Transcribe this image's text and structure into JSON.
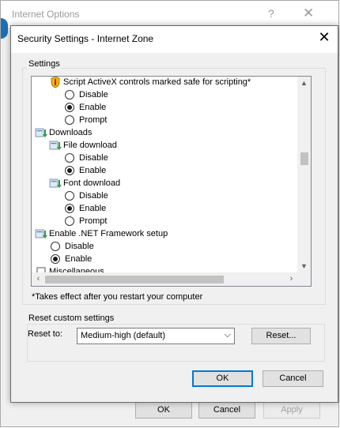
{
  "background_window": {
    "title": "Internet Options",
    "help_glyph": "?",
    "close_glyph": "✕",
    "buttons": {
      "ok": "OK",
      "cancel": "Cancel",
      "apply": "Apply"
    }
  },
  "dialog": {
    "title": "Security Settings - Internet Zone",
    "close_glyph": "✕",
    "settings_group_label": "Settings",
    "tree": [
      {
        "type": "item",
        "icon": "activex-shield-icon",
        "label": "Script ActiveX controls marked safe for scripting*"
      },
      {
        "type": "radio",
        "label": "Disable",
        "checked": false
      },
      {
        "type": "radio",
        "label": "Enable",
        "checked": true
      },
      {
        "type": "radio",
        "label": "Prompt",
        "checked": false
      },
      {
        "type": "category",
        "icon": "download-icon",
        "label": "Downloads"
      },
      {
        "type": "item",
        "icon": "download-icon",
        "label": "File download"
      },
      {
        "type": "radio",
        "label": "Disable",
        "checked": false
      },
      {
        "type": "radio",
        "label": "Enable",
        "checked": true
      },
      {
        "type": "item",
        "icon": "download-icon",
        "label": "Font download"
      },
      {
        "type": "radio",
        "label": "Disable",
        "checked": false
      },
      {
        "type": "radio",
        "label": "Enable",
        "checked": true
      },
      {
        "type": "radio",
        "label": "Prompt",
        "checked": false
      },
      {
        "type": "item",
        "icon": "download-icon",
        "label": "Enable .NET Framework setup"
      },
      {
        "type": "radio",
        "label": "Disable",
        "checked": false
      },
      {
        "type": "radio",
        "label": "Enable",
        "checked": true
      },
      {
        "type": "category",
        "icon": "checkbox-icon",
        "label": "Miscellaneous"
      }
    ],
    "note": "*Takes effect after you restart your computer",
    "reset_group_label": "Reset custom settings",
    "reset_to_label": "Reset to:",
    "reset_to_value": "Medium-high (default)",
    "reset_button": "Reset...",
    "ok_button": "OK",
    "cancel_button": "Cancel"
  }
}
